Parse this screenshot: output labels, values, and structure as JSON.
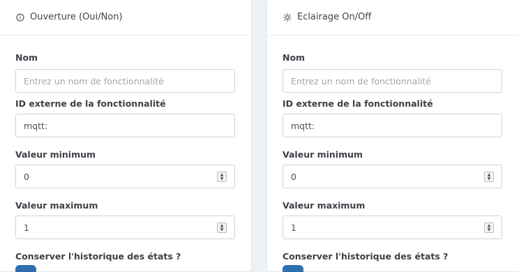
{
  "cards": [
    {
      "title": "Ouverture (Oui/Non)",
      "icon": "info-circle-icon",
      "name_label": "Nom",
      "name_placeholder": "Entrez un nom de fonctionnalité",
      "external_id_label": "ID externe de la fonctionnalité",
      "external_id_value": "mqtt:",
      "min_label": "Valeur minimum",
      "min_value": "0",
      "max_label": "Valeur maximum",
      "max_value": "1",
      "history_label": "Conserver l'historique des états ?"
    },
    {
      "title": "Eclairage On/Off",
      "icon": "sun-icon",
      "name_label": "Nom",
      "name_placeholder": "Entrez un nom de fonctionnalité",
      "external_id_label": "ID externe de la fonctionnalité",
      "external_id_value": "mqtt:",
      "min_label": "Valeur minimum",
      "min_value": "0",
      "max_label": "Valeur maximum",
      "max_value": "1",
      "history_label": "Conserver l'historique des états ?"
    }
  ],
  "colors": {
    "toggle_on": "#2f6fb0",
    "border": "#ced4da"
  }
}
